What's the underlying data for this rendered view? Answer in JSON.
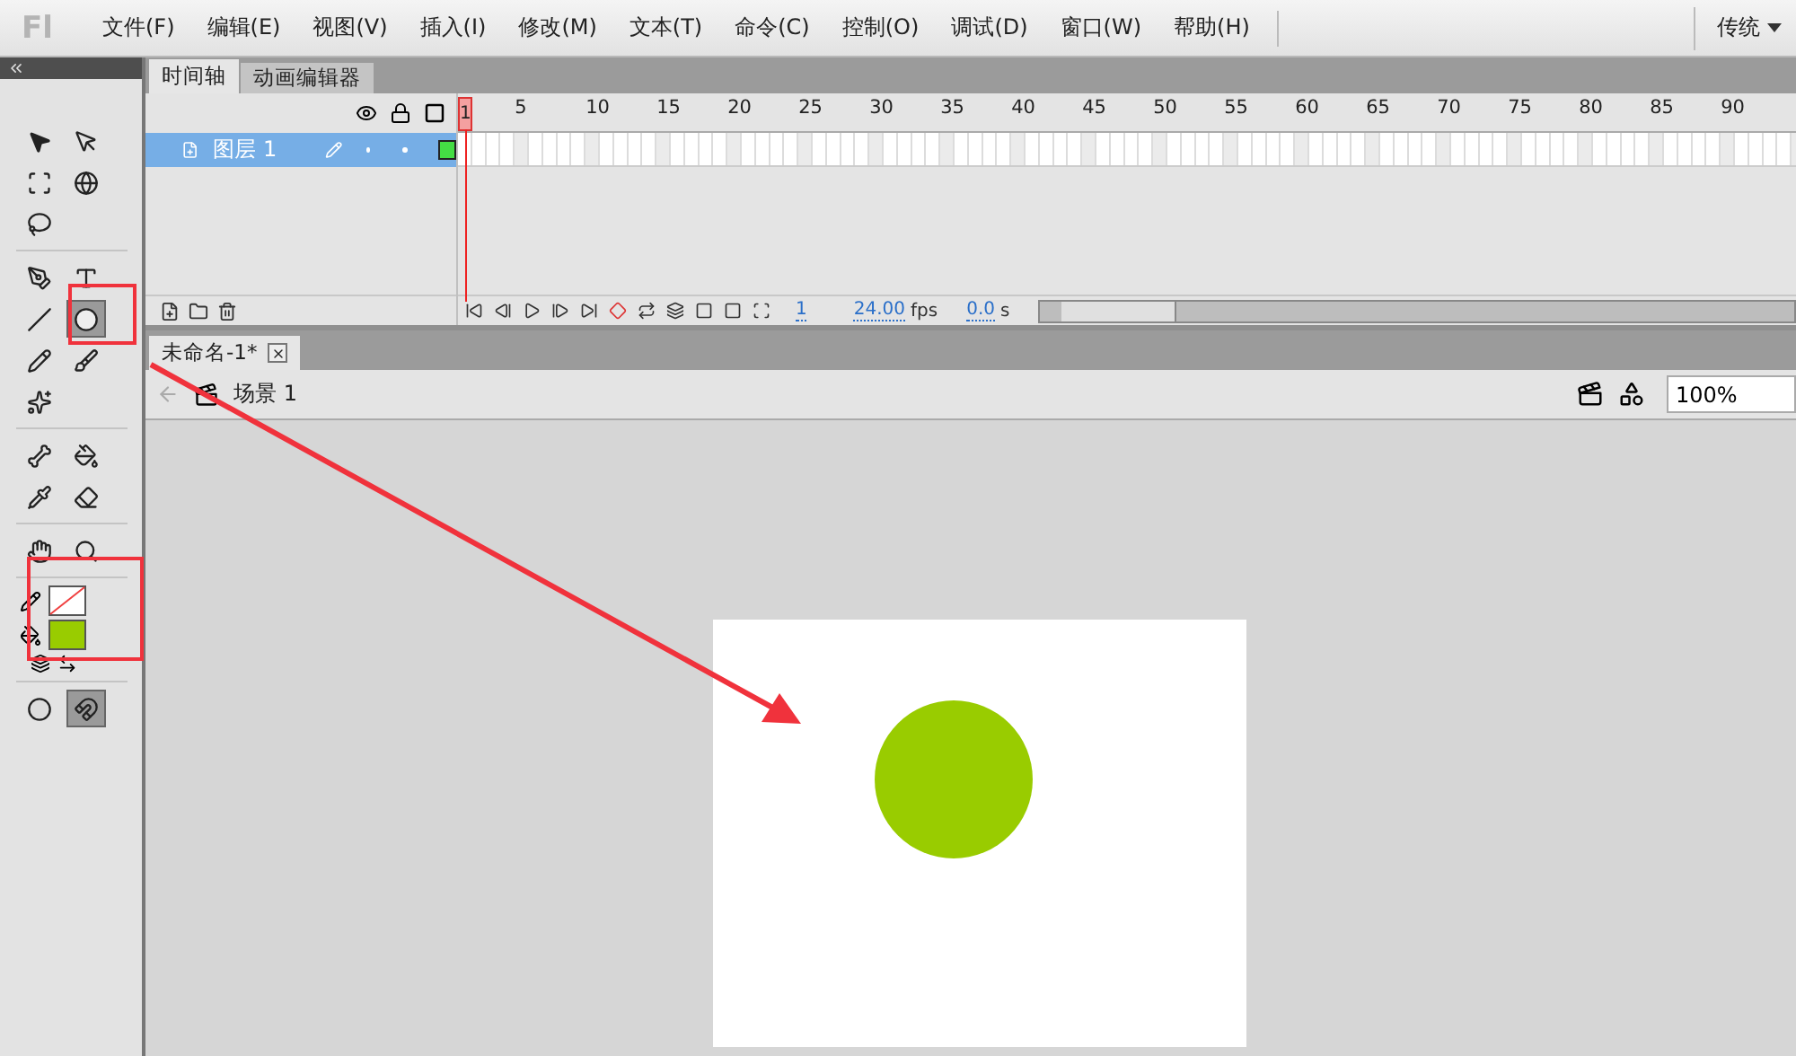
{
  "app_logo": "Fl",
  "menu": [
    {
      "label": "文件(F)"
    },
    {
      "label": "编辑(E)"
    },
    {
      "label": "视图(V)"
    },
    {
      "label": "插入(I)"
    },
    {
      "label": "修改(M)"
    },
    {
      "label": "文本(T)"
    },
    {
      "label": "命令(C)"
    },
    {
      "label": "控制(O)"
    },
    {
      "label": "调试(D)"
    },
    {
      "label": "窗口(W)"
    },
    {
      "label": "帮助(H)"
    }
  ],
  "workspace": "传统",
  "tool_groups": [
    {
      "rows": [
        [
          {
            "kind": "selection",
            "selected": false
          },
          {
            "kind": "subselection",
            "selected": false
          }
        ],
        [
          {
            "kind": "free-transform",
            "selected": false
          },
          {
            "kind": "rotation-3d",
            "selected": false
          }
        ],
        [
          {
            "kind": "lasso",
            "selected": false
          }
        ]
      ]
    },
    {
      "rows": [
        [
          {
            "kind": "pen",
            "selected": false
          },
          {
            "kind": "text",
            "selected": false
          }
        ],
        [
          {
            "kind": "line",
            "selected": false
          },
          {
            "kind": "ellipse",
            "selected": true
          }
        ],
        [
          {
            "kind": "pencil",
            "selected": false
          },
          {
            "kind": "brush",
            "selected": false
          }
        ],
        [
          {
            "kind": "deco",
            "selected": false
          }
        ]
      ]
    },
    {
      "rows": [
        [
          {
            "kind": "bone",
            "selected": false
          },
          {
            "kind": "paint-bucket",
            "selected": false
          }
        ],
        [
          {
            "kind": "eyedropper",
            "selected": false
          },
          {
            "kind": "eraser",
            "selected": false
          }
        ]
      ]
    },
    {
      "rows": [
        [
          {
            "kind": "hand",
            "selected": false
          },
          {
            "kind": "zoom",
            "selected": false
          }
        ]
      ]
    }
  ],
  "swatches": [
    {
      "kind": "stroke",
      "empty": true,
      "color": "#ffffff"
    },
    {
      "kind": "fill",
      "empty": false,
      "color": "#99cc00"
    }
  ],
  "options": [
    {
      "kind": "object-drawing",
      "selected": false
    },
    {
      "kind": "snap",
      "selected": true
    }
  ],
  "panel_tabs": [
    {
      "label": "时间轴",
      "selected": true
    },
    {
      "label": "动画编辑器",
      "selected": false
    }
  ],
  "timeline": {
    "current_frame": "1",
    "frame_numbers": [
      "5",
      "10",
      "15",
      "20",
      "25",
      "30",
      "35",
      "40",
      "45",
      "50",
      "55",
      "60",
      "65",
      "70",
      "75",
      "80",
      "85",
      "90"
    ],
    "layers": [
      {
        "name": "图层 1",
        "selected": true,
        "color": "#44dd44"
      }
    ],
    "status": {
      "frame": "1",
      "fps": "24.00",
      "fps_unit": "fps",
      "time": "0.0",
      "time_unit": "s"
    }
  },
  "document_tabs": [
    {
      "label": "未命名-1*",
      "selected": true
    }
  ],
  "breadcrumb": "场景 1",
  "zoom": "100%",
  "stage": {
    "shape": {
      "kind": "circle",
      "color": "#99cc00"
    }
  }
}
